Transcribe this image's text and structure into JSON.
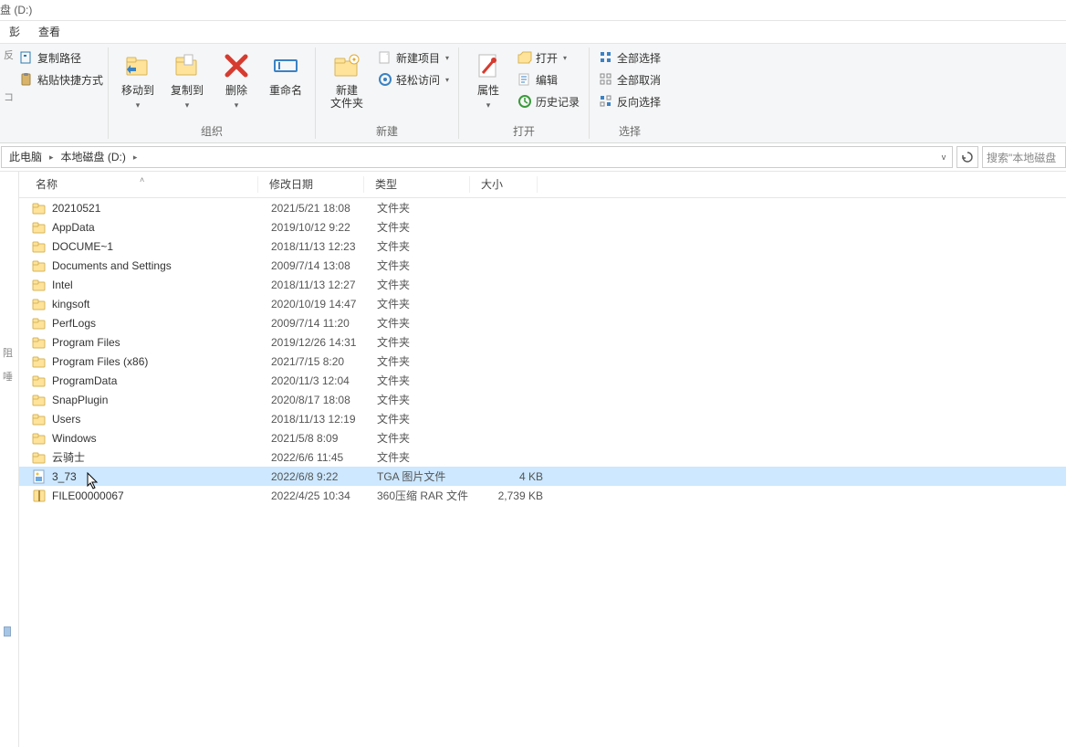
{
  "window": {
    "title_fragment": "盘 (D:)"
  },
  "menu": {
    "item0_fragment": "彭",
    "view": "查看"
  },
  "ribbon": {
    "clipboard": {
      "copy_path": "复制路径",
      "paste_shortcut": "粘贴快捷方式",
      "left_fragment1": "反",
      "left_fragment2": "コ"
    },
    "organize": {
      "move_to": "移动到",
      "copy_to": "复制到",
      "delete": "删除",
      "rename": "重命名",
      "group_label": "组织"
    },
    "new": {
      "new_folder": "新建",
      "new_folder_line2": "文件夹",
      "new_item": "新建项目",
      "easy_access": "轻松访问",
      "group_label": "新建"
    },
    "open": {
      "properties": "属性",
      "open": "打开",
      "edit": "编辑",
      "history": "历史记录",
      "group_label": "打开"
    },
    "select": {
      "select_all": "全部选择",
      "select_none": "全部取消",
      "invert": "反向选择",
      "group_label": "选择"
    }
  },
  "breadcrumb": {
    "this_pc": "此电脑",
    "drive": "本地磁盘 (D:)"
  },
  "search": {
    "placeholder": "搜索\"本地磁盘"
  },
  "navpane": {
    "frag1": "阻",
    "frag2": "唾"
  },
  "columns": {
    "name": "名称",
    "date": "修改日期",
    "type": "类型",
    "size": "大小"
  },
  "files": [
    {
      "icon": "folder",
      "name": "20210521",
      "date": "2021/5/21 18:08",
      "type": "文件夹",
      "size": ""
    },
    {
      "icon": "folder",
      "name": "AppData",
      "date": "2019/10/12 9:22",
      "type": "文件夹",
      "size": ""
    },
    {
      "icon": "folder",
      "name": "DOCUME~1",
      "date": "2018/11/13 12:23",
      "type": "文件夹",
      "size": ""
    },
    {
      "icon": "folder",
      "name": "Documents and Settings",
      "date": "2009/7/14 13:08",
      "type": "文件夹",
      "size": ""
    },
    {
      "icon": "folder",
      "name": "Intel",
      "date": "2018/11/13 12:27",
      "type": "文件夹",
      "size": ""
    },
    {
      "icon": "folder",
      "name": "kingsoft",
      "date": "2020/10/19 14:47",
      "type": "文件夹",
      "size": ""
    },
    {
      "icon": "folder",
      "name": "PerfLogs",
      "date": "2009/7/14 11:20",
      "type": "文件夹",
      "size": ""
    },
    {
      "icon": "folder",
      "name": "Program Files",
      "date": "2019/12/26 14:31",
      "type": "文件夹",
      "size": ""
    },
    {
      "icon": "folder",
      "name": "Program Files (x86)",
      "date": "2021/7/15 8:20",
      "type": "文件夹",
      "size": ""
    },
    {
      "icon": "folder",
      "name": "ProgramData",
      "date": "2020/11/3 12:04",
      "type": "文件夹",
      "size": ""
    },
    {
      "icon": "folder",
      "name": "SnapPlugin",
      "date": "2020/8/17 18:08",
      "type": "文件夹",
      "size": ""
    },
    {
      "icon": "folder",
      "name": "Users",
      "date": "2018/11/13 12:19",
      "type": "文件夹",
      "size": ""
    },
    {
      "icon": "folder",
      "name": "Windows",
      "date": "2021/5/8 8:09",
      "type": "文件夹",
      "size": ""
    },
    {
      "icon": "folder",
      "name": "云骑士",
      "date": "2022/6/6 11:45",
      "type": "文件夹",
      "size": ""
    },
    {
      "icon": "tga",
      "name": "3_73",
      "date": "2022/6/8 9:22",
      "type": "TGA 图片文件",
      "size": "4 KB",
      "selected": true
    },
    {
      "icon": "rar",
      "name": "FILE00000067",
      "date": "2022/4/25 10:34",
      "type": "360压缩 RAR 文件",
      "size": "2,739 KB"
    }
  ]
}
